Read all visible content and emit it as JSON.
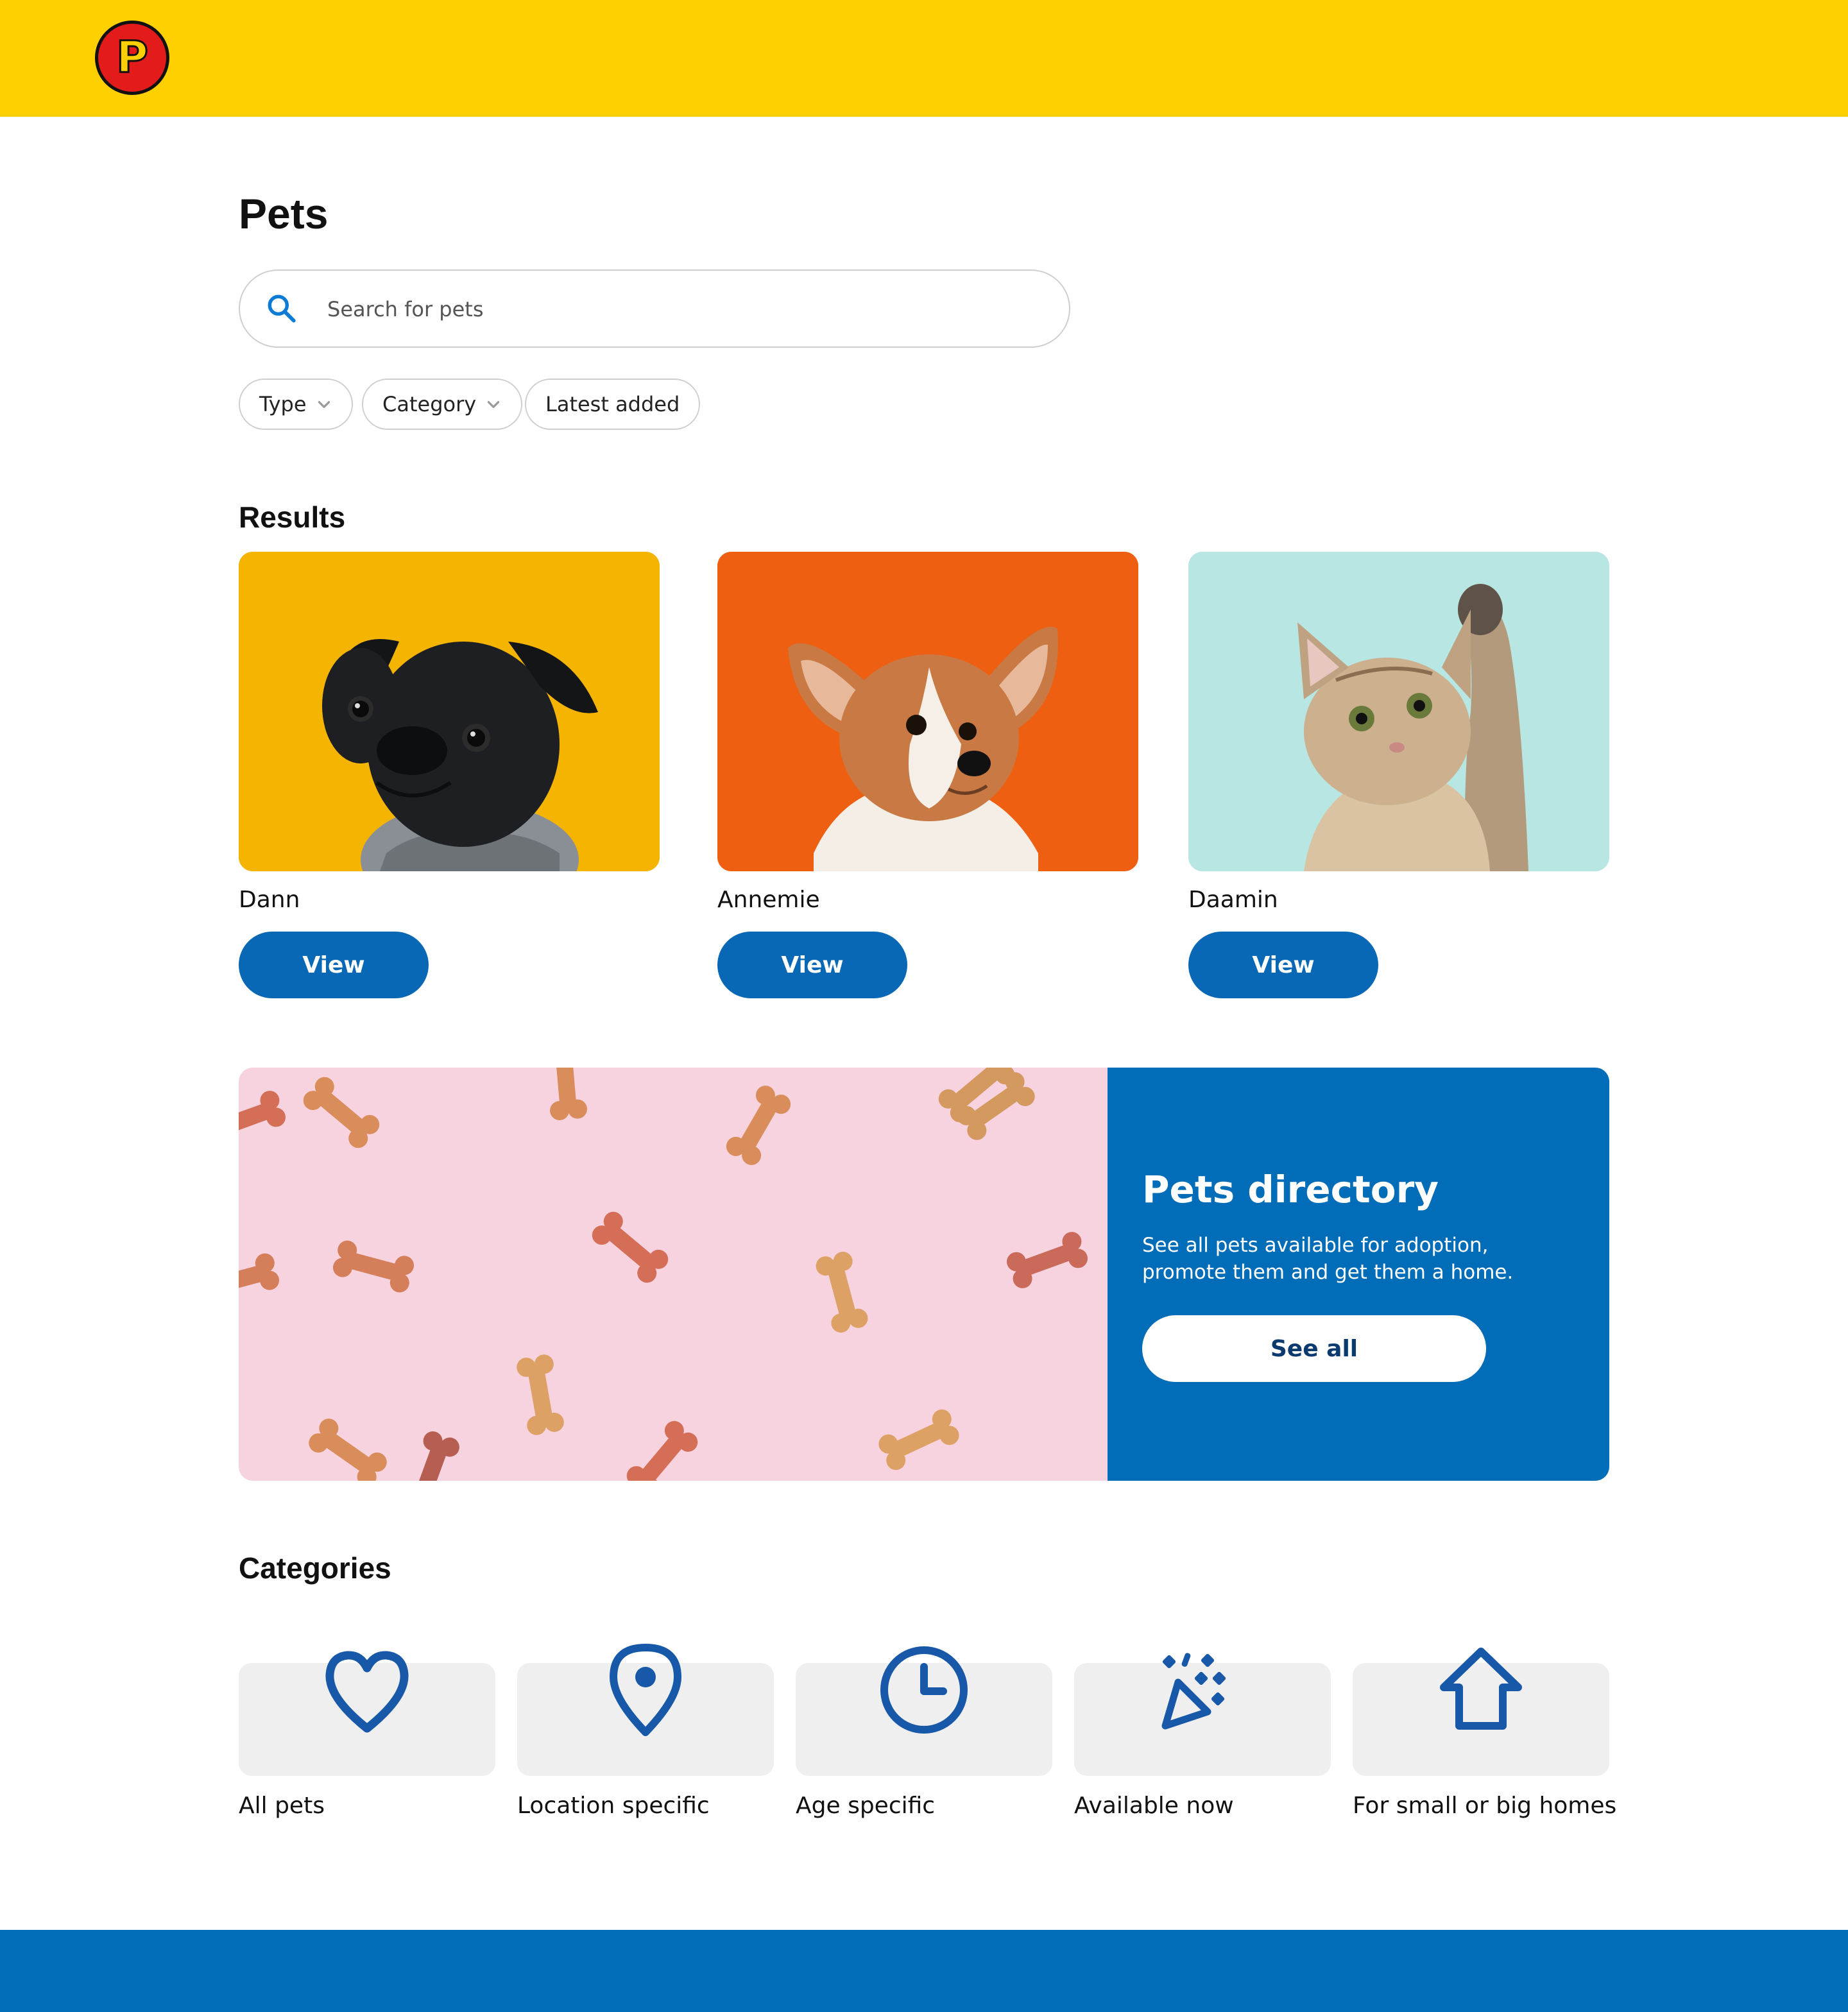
{
  "header": {
    "logo_letter": "P",
    "brand_color": "#FFD000"
  },
  "page": {
    "title": "Pets"
  },
  "search": {
    "placeholder": "Search for pets",
    "value": ""
  },
  "filters": [
    {
      "label": "Type",
      "has_dropdown": true
    },
    {
      "label": "Category",
      "has_dropdown": true
    },
    {
      "label": "Latest added",
      "has_dropdown": false
    }
  ],
  "results": {
    "title": "Results",
    "items": [
      {
        "name": "Dann",
        "button": "View",
        "image": "black-pug-on-yellow"
      },
      {
        "name": "Annemie",
        "button": "View",
        "image": "corgi-puppy-on-orange"
      },
      {
        "name": "Daamin",
        "button": "View",
        "image": "kitten-on-mint"
      }
    ]
  },
  "promo": {
    "image": "dog-biscuits-on-pink",
    "title": "Pets directory",
    "description": "See all pets available for adoption, promote them and get them a home.",
    "button": "See all"
  },
  "categories": {
    "title": "Categories",
    "items": [
      {
        "label": "All pets",
        "icon": "heart-icon"
      },
      {
        "label": "Location specific",
        "icon": "location-pin-icon"
      },
      {
        "label": "Age specific",
        "icon": "clock-icon"
      },
      {
        "label": "Available now",
        "icon": "party-popper-icon"
      },
      {
        "label": "For small or big homes",
        "icon": "house-icon"
      }
    ]
  },
  "colors": {
    "primary": "#016CB7",
    "accent": "#FFD000",
    "tile": "#EFEFEF"
  }
}
